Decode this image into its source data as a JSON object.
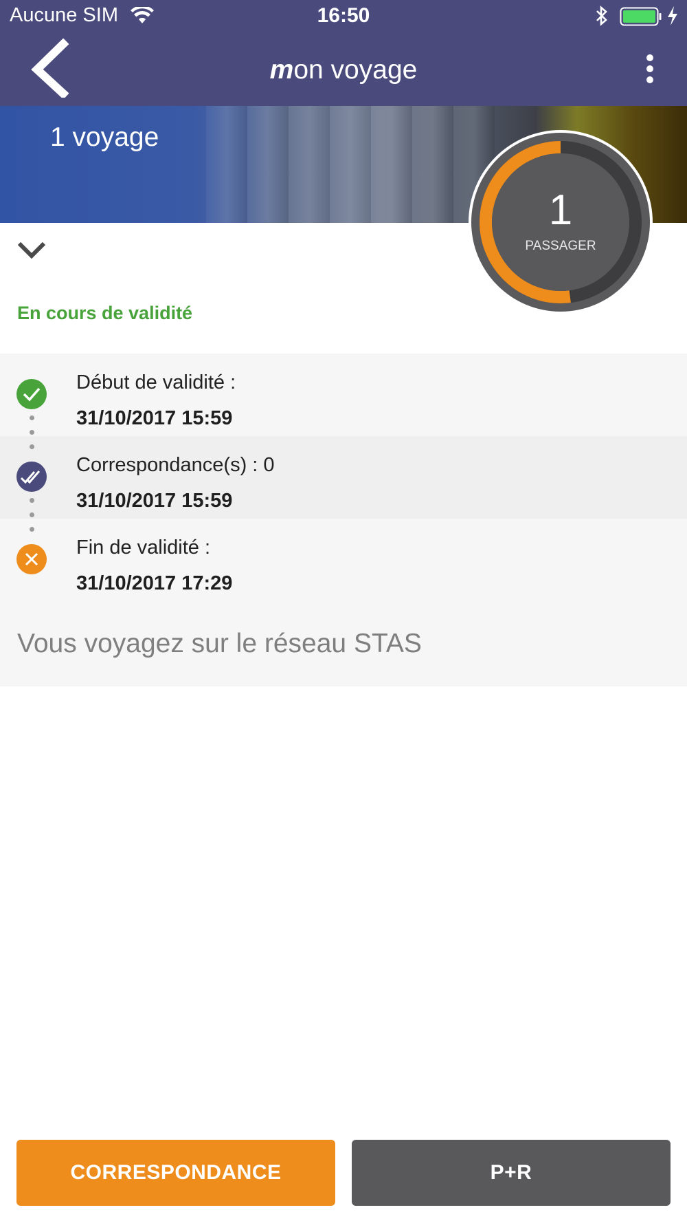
{
  "status_bar": {
    "carrier": "Aucune SIM",
    "time": "16:50"
  },
  "nav": {
    "title_prefix": "m",
    "title_rest": "on voyage"
  },
  "hero": {
    "trip_count": "1 voyage"
  },
  "passenger": {
    "count": "1",
    "label": "PASSAGER",
    "progress": 0.52
  },
  "validity": {
    "status": "En cours de validité"
  },
  "timeline": [
    {
      "label": "Début de validité :",
      "value": "31/10/2017 15:59",
      "icon": "check-icon"
    },
    {
      "label": "Correspondance(s) : 0",
      "value": "31/10/2017 15:59",
      "icon": "double-check-icon"
    },
    {
      "label": "Fin de validité :",
      "value": "31/10/2017 17:29",
      "icon": "close-icon"
    }
  ],
  "network_text": "Vous voyagez sur le réseau STAS",
  "buttons": {
    "correspondance": "CORRESPONDANCE",
    "pr": "P+R"
  },
  "colors": {
    "nav_bg": "#4a4a7c",
    "accent_orange": "#ee8d1c",
    "valid_green": "#47a33a",
    "transfer_purple": "#4a4a7c",
    "secondary_button": "#59595c"
  }
}
